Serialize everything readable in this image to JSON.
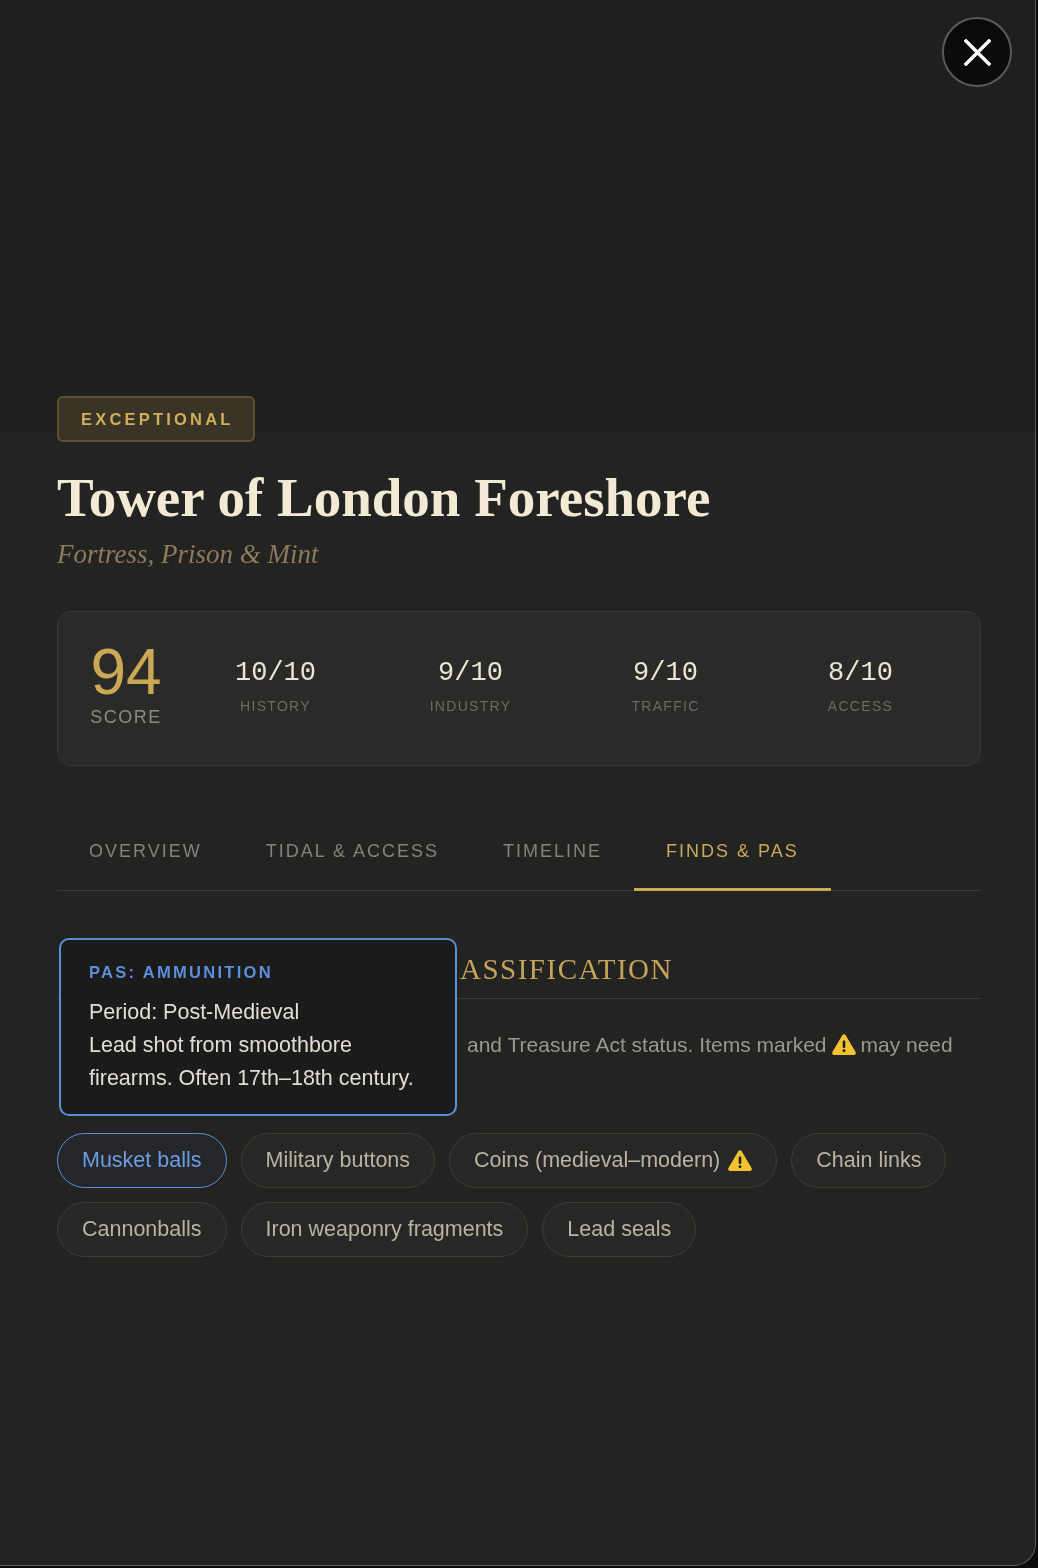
{
  "badge": "EXCEPTIONAL",
  "title": "Tower of London Foreshore",
  "subtitle": "Fortress, Prison & Mint",
  "score": {
    "value": "94",
    "label": "SCORE"
  },
  "stats": [
    {
      "value": "10/10",
      "label": "HISTORY"
    },
    {
      "value": "9/10",
      "label": "INDUSTRY"
    },
    {
      "value": "9/10",
      "label": "TRAFFIC"
    },
    {
      "value": "8/10",
      "label": "ACCESS"
    }
  ],
  "tabs": [
    {
      "label": "OVERVIEW",
      "selected": false
    },
    {
      "label": "TIDAL & ACCESS",
      "selected": false
    },
    {
      "label": "TIMELINE",
      "selected": false
    },
    {
      "label": "FINDS & PAS",
      "selected": true
    }
  ],
  "section": {
    "heading": "ASSIFICATION",
    "description": {
      "before": "and Treasure Act status. Items marked",
      "after": "may need"
    }
  },
  "tooltip": {
    "title": "PAS: AMMUNITION",
    "period": "Period: Post-Medieval",
    "text": "Lead shot from smoothbore firearms. Often 17th–18th century."
  },
  "finds": [
    {
      "label": "Musket balls",
      "selected": true,
      "warning": false
    },
    {
      "label": "Military buttons",
      "selected": false,
      "warning": false
    },
    {
      "label": "Coins (medieval–modern)",
      "selected": false,
      "warning": true
    },
    {
      "label": "Chain links",
      "selected": false,
      "warning": false
    },
    {
      "label": "Cannonballs",
      "selected": false,
      "warning": false
    },
    {
      "label": "Iron weaponry fragments",
      "selected": false,
      "warning": false
    },
    {
      "label": "Lead seals",
      "selected": false,
      "warning": false
    }
  ]
}
